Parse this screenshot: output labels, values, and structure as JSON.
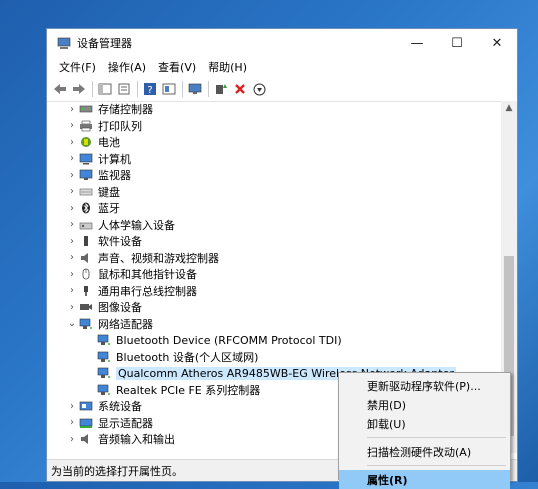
{
  "window": {
    "title": "设备管理器",
    "minimize": "—",
    "maximize": "☐",
    "close": "✕"
  },
  "menu": [
    "文件(F)",
    "操作(A)",
    "查看(V)",
    "帮助(H)"
  ],
  "tree": [
    {
      "label": "存储控制器",
      "icon": "storage-controller-icon",
      "level": 0,
      "arrow": "›"
    },
    {
      "label": "打印队列",
      "icon": "printer-icon",
      "level": 0,
      "arrow": "›"
    },
    {
      "label": "电池",
      "icon": "battery-icon",
      "level": 0,
      "arrow": "›"
    },
    {
      "label": "计算机",
      "icon": "computer-icon",
      "level": 0,
      "arrow": "›"
    },
    {
      "label": "监视器",
      "icon": "monitor-icon",
      "level": 0,
      "arrow": "›"
    },
    {
      "label": "键盘",
      "icon": "keyboard-icon",
      "level": 0,
      "arrow": "›"
    },
    {
      "label": "蓝牙",
      "icon": "bluetooth-icon",
      "level": 0,
      "arrow": "›"
    },
    {
      "label": "人体学输入设备",
      "icon": "hid-icon",
      "level": 0,
      "arrow": "›"
    },
    {
      "label": "软件设备",
      "icon": "software-device-icon",
      "level": 0,
      "arrow": "›"
    },
    {
      "label": "声音、视频和游戏控制器",
      "icon": "speaker-icon",
      "level": 0,
      "arrow": "›"
    },
    {
      "label": "鼠标和其他指针设备",
      "icon": "mouse-icon",
      "level": 0,
      "arrow": "›"
    },
    {
      "label": "通用串行总线控制器",
      "icon": "usb-icon",
      "level": 0,
      "arrow": "›"
    },
    {
      "label": "图像设备",
      "icon": "camera-icon",
      "level": 0,
      "arrow": "›"
    },
    {
      "label": "网络适配器",
      "icon": "network-adapter-icon",
      "level": 0,
      "arrow": "⌄"
    },
    {
      "label": "Bluetooth Device (RFCOMM Protocol TDI)",
      "icon": "network-adapter-icon",
      "level": 1,
      "arrow": ""
    },
    {
      "label": "Bluetooth 设备(个人区域网)",
      "icon": "network-adapter-icon",
      "level": 1,
      "arrow": ""
    },
    {
      "label": "Qualcomm Atheros AR9485WB-EG Wireless Network Adapter",
      "icon": "network-adapter-icon",
      "level": 1,
      "arrow": "",
      "selected": true
    },
    {
      "label": "Realtek PCIe FE 系列控制器",
      "icon": "network-adapter-icon",
      "level": 1,
      "arrow": ""
    },
    {
      "label": "系统设备",
      "icon": "system-device-icon",
      "level": 0,
      "arrow": "›"
    },
    {
      "label": "显示适配器",
      "icon": "display-adapter-icon",
      "level": 0,
      "arrow": "›"
    },
    {
      "label": "音频输入和输出",
      "icon": "audio-io-icon",
      "level": 0,
      "arrow": "›"
    }
  ],
  "status": "为当前的选择打开属性页。",
  "context_menu": {
    "items": [
      {
        "label": "更新驱动程序软件(P)..."
      },
      {
        "label": "禁用(D)"
      },
      {
        "label": "卸载(U)"
      },
      {
        "separator": true
      },
      {
        "label": "扫描检测硬件改动(A)"
      },
      {
        "separator": true
      },
      {
        "label": "属性(R)",
        "highlight": true
      }
    ]
  },
  "colors": {
    "selection": "#cce8ff",
    "menu_highlight": "#91c9f7",
    "desktop": "#2b77c8"
  }
}
